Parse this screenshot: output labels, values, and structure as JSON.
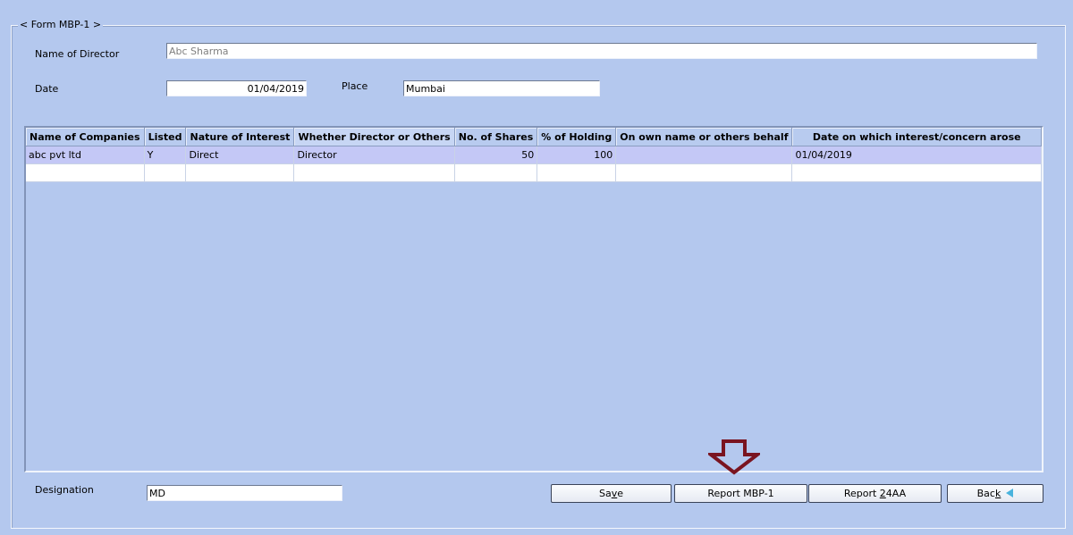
{
  "form": {
    "title": "< Form MBP-1 >",
    "name_label": "Name of Director",
    "name_value": "Abc Sharma",
    "date_label": "Date",
    "date_value": "01/04/2019",
    "place_label": "Place",
    "place_value": "Mumbai",
    "designation_label": "Designation",
    "designation_value": "MD"
  },
  "table": {
    "columns": [
      "Name of Companies",
      "Listed",
      "Nature of Interest",
      "Whether Director or Others",
      "No. of Shares",
      "% of Holding",
      "On own name or others behalf",
      "Date on which interest/concern arose"
    ],
    "rows": [
      [
        "abc pvt ltd",
        "Y",
        "Direct",
        "Director",
        "50",
        "100",
        "",
        "01/04/2019"
      ]
    ]
  },
  "buttons": {
    "save_pre": "Sa",
    "save_key": "v",
    "save_post": "e",
    "report_mbp1": "Report MBP-1",
    "report24_pre": "Report ",
    "report24_key": "2",
    "report24_post": "4AA",
    "back_pre": "Bac",
    "back_key": "k",
    "back_icon": "back-arrow-icon"
  },
  "colors": {
    "background": "#b4c8ee",
    "selected_row": "#c4c8f6",
    "arrow": "#7a1420",
    "back_icon": "#49b3dd"
  }
}
